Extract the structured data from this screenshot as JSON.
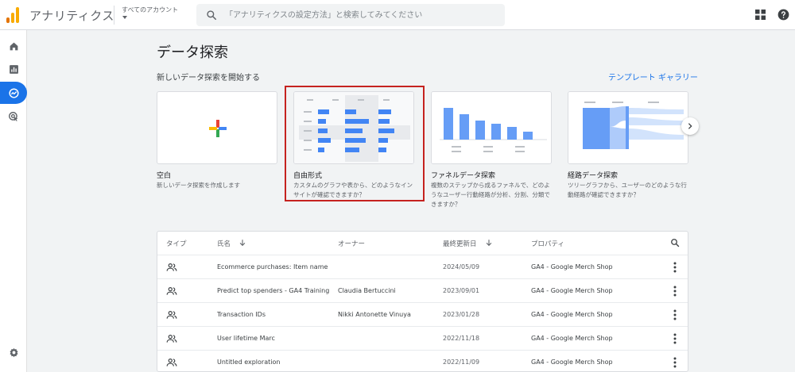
{
  "header": {
    "app_title": "アナリティクス",
    "account_label": "すべてのアカウント",
    "search_placeholder": "「アナリティクスの設定方法」と検索してみてください"
  },
  "main": {
    "page_title": "データ探索",
    "start_label": "新しいデータ探索を開始する",
    "gallery_link": "テンプレート ギャラリー",
    "templates": [
      {
        "name": "空白",
        "desc": "新しいデータ探索を作成します"
      },
      {
        "name": "自由形式",
        "desc": "カスタムのグラフや表から、どのようなインサイトが確認できますか？"
      },
      {
        "name": "ファネルデータ探索",
        "desc": "複数のステップから成るファネルで、どのようなユーザー行動経路が分析、分割、分類できますか？"
      },
      {
        "name": "経路データ探索",
        "desc": "ツリーグラフから、ユーザーのどのような行動経路が確認できますか？"
      }
    ]
  },
  "table": {
    "columns": [
      "タイプ",
      "氏名",
      "オーナー",
      "最終更新日",
      "プロパティ"
    ],
    "rows": [
      {
        "name": "Ecommerce purchases: Item name",
        "owner": "",
        "date": "2024/05/09",
        "property": "GA4 - Google Merch Shop"
      },
      {
        "name": "Predict top spenders - GA4 Training",
        "owner": "Claudia Bertuccini",
        "date": "2023/09/01",
        "property": "GA4 - Google Merch Shop"
      },
      {
        "name": "Transaction IDs",
        "owner": "Nikki Antonette Vinuya",
        "date": "2023/01/28",
        "property": "GA4 - Google Merch Shop"
      },
      {
        "name": "User lifetime Marc",
        "owner": "",
        "date": "2022/11/18",
        "property": "GA4 - Google Merch Shop"
      },
      {
        "name": "Untitled exploration",
        "owner": "",
        "date": "2022/11/09",
        "property": "GA4 - Google Merch Shop"
      }
    ]
  },
  "colors": {
    "accent": "#1a73e8",
    "highlight": "#c5221f",
    "logo_orange": "#f9ab00",
    "logo_dark": "#e37400"
  },
  "icons": {
    "rail": [
      "home-icon",
      "reports-icon",
      "explore-icon",
      "advertising-icon",
      "settings-icon"
    ],
    "header": [
      "search-icon",
      "apps-grid-icon",
      "help-icon"
    ]
  }
}
